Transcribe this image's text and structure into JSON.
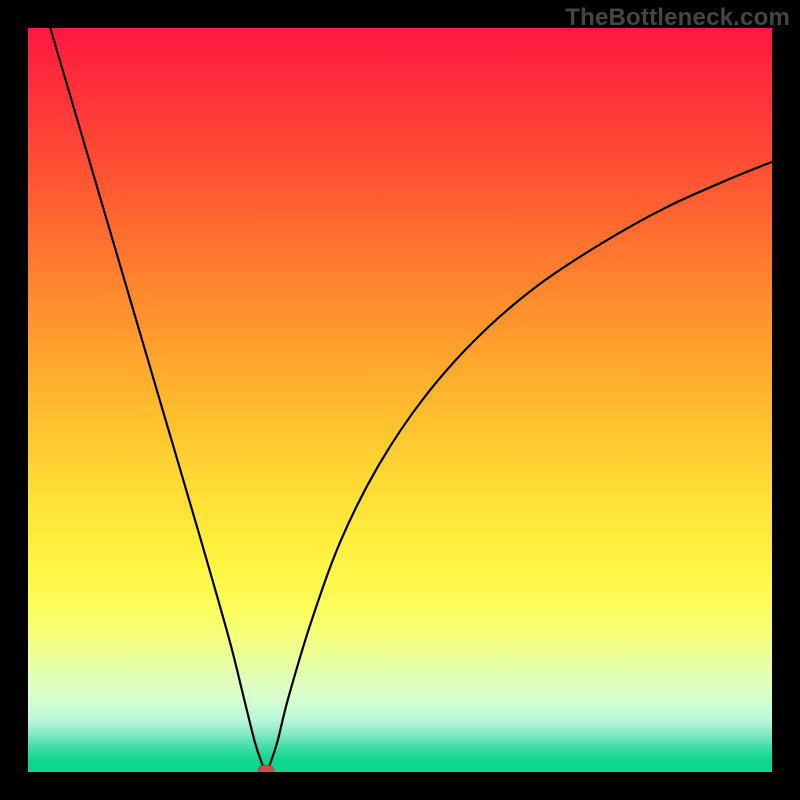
{
  "watermark": {
    "text": "TheBottleneck.com"
  },
  "chart_data": {
    "type": "line",
    "title": "",
    "xlabel": "",
    "ylabel": "",
    "xlim": [
      0,
      100
    ],
    "ylim": [
      0,
      100
    ],
    "grid": false,
    "legend": false,
    "gradient_stops": [
      {
        "pos": 0,
        "color": "#ff1744"
      },
      {
        "pos": 20,
        "color": "#ff5433"
      },
      {
        "pos": 40,
        "color": "#ff982c"
      },
      {
        "pos": 60,
        "color": "#ffd733"
      },
      {
        "pos": 80,
        "color": "#f9ff6b"
      },
      {
        "pos": 100,
        "color": "#0cd68f"
      }
    ],
    "series": [
      {
        "name": "bottleneck-curve",
        "x_minimum": 32,
        "points": [
          {
            "x": 3,
            "y": 100
          },
          {
            "x": 8,
            "y": 83
          },
          {
            "x": 13,
            "y": 66
          },
          {
            "x": 18,
            "y": 49
          },
          {
            "x": 23,
            "y": 32
          },
          {
            "x": 27,
            "y": 18
          },
          {
            "x": 29,
            "y": 10
          },
          {
            "x": 30.5,
            "y": 4
          },
          {
            "x": 31.5,
            "y": 1
          },
          {
            "x": 32,
            "y": 0
          },
          {
            "x": 32.5,
            "y": 1
          },
          {
            "x": 33.5,
            "y": 4
          },
          {
            "x": 35,
            "y": 10
          },
          {
            "x": 38,
            "y": 20
          },
          {
            "x": 42,
            "y": 31
          },
          {
            "x": 47,
            "y": 41
          },
          {
            "x": 53,
            "y": 50
          },
          {
            "x": 60,
            "y": 58
          },
          {
            "x": 68,
            "y": 65
          },
          {
            "x": 77,
            "y": 71
          },
          {
            "x": 86,
            "y": 76
          },
          {
            "x": 95,
            "y": 80
          },
          {
            "x": 100,
            "y": 82
          }
        ]
      }
    ],
    "marker": {
      "x": 32,
      "y": 0,
      "rx": 8,
      "ry": 5,
      "color": "#ce4f44"
    }
  }
}
